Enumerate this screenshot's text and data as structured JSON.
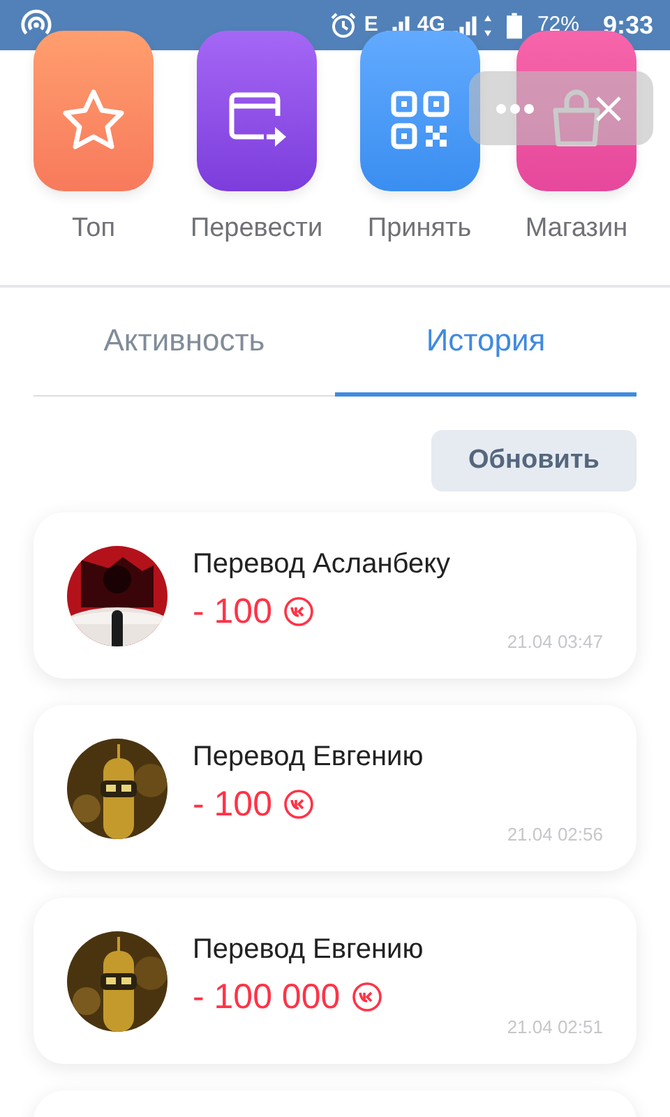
{
  "status_bar": {
    "network_e": "E",
    "network_4g": "4G",
    "battery": "72%",
    "time": "9:33"
  },
  "actions": [
    {
      "kind": "star",
      "label": "Топ"
    },
    {
      "kind": "transfer",
      "label": "Перевести"
    },
    {
      "kind": "qr",
      "label": "Принять"
    },
    {
      "kind": "bag",
      "label": "Магазин"
    }
  ],
  "tabs": [
    {
      "label": "Активность",
      "selected": false
    },
    {
      "label": "История",
      "selected": true
    }
  ],
  "refresh_button": "Обновить",
  "transactions": [
    {
      "title": "Перевод Асланбеку",
      "amount": "- 100",
      "time": "21.04 03:47"
    },
    {
      "title": "Перевод Евгению",
      "amount": "- 100",
      "time": "21.04 02:56"
    },
    {
      "title": "Перевод Евгению",
      "amount": "- 100 000",
      "time": "21.04 02:51"
    }
  ]
}
